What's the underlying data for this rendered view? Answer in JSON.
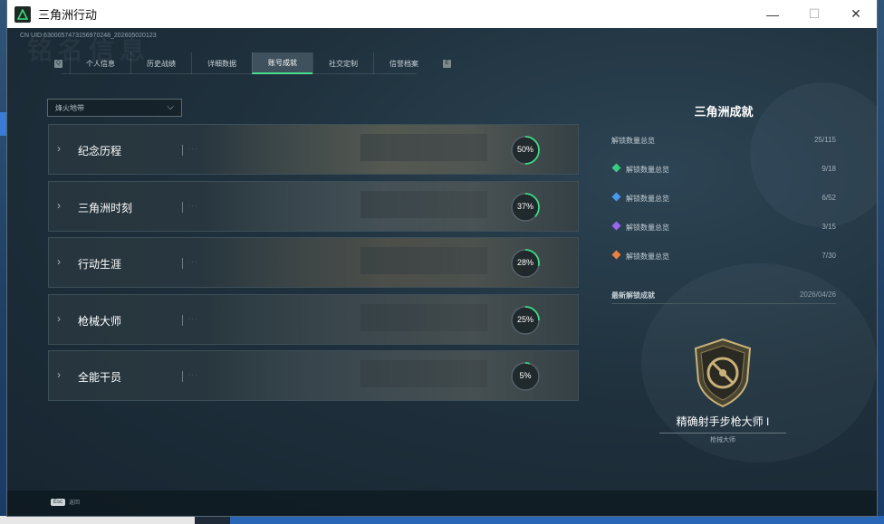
{
  "window": {
    "title": "三角洲行动",
    "min": "—",
    "max": "☐",
    "close": "✕"
  },
  "header": {
    "cn_id": "CN UID:6300057473156970248_202605020123",
    "bg_text": "铭名信息"
  },
  "tabs": [
    "个人信息",
    "历史战绩",
    "详细数据",
    "账号成就",
    "社交定制",
    "信誉档案"
  ],
  "active_tab": "账号成就",
  "filter": {
    "value": "烽火地带"
  },
  "categories": [
    {
      "name": "纪念历程",
      "percent": "50%",
      "fraction": 0.5
    },
    {
      "name": "三角洲时刻",
      "percent": "37%",
      "fraction": 0.37
    },
    {
      "name": "行动生涯",
      "percent": "28%",
      "fraction": 0.28
    },
    {
      "name": "枪械大师",
      "percent": "25%",
      "fraction": 0.25
    },
    {
      "name": "全能干员",
      "percent": "5%",
      "fraction": 0.05
    }
  ],
  "panel": {
    "title": "三角洲成就",
    "total": {
      "label": "解锁数量总览",
      "value": "25/115"
    },
    "rows": [
      {
        "label": "解锁数量总览",
        "value": "9/18",
        "color": "#3ddc84"
      },
      {
        "label": "解锁数量总览",
        "value": "6/52",
        "color": "#4aa3ff"
      },
      {
        "label": "解锁数量总览",
        "value": "3/15",
        "color": "#a66bff"
      },
      {
        "label": "解锁数量总览",
        "value": "7/30",
        "color": "#ff8a3d"
      }
    ],
    "latest": {
      "label": "最新解锁成就",
      "date": "2026/04/26"
    },
    "achievement": {
      "name": "精确射手步枪大师 I",
      "sub": "枪械大师"
    }
  },
  "footer": {
    "key": "Esc",
    "label": "返回"
  },
  "colors": {
    "accent": "#3ddc84"
  }
}
